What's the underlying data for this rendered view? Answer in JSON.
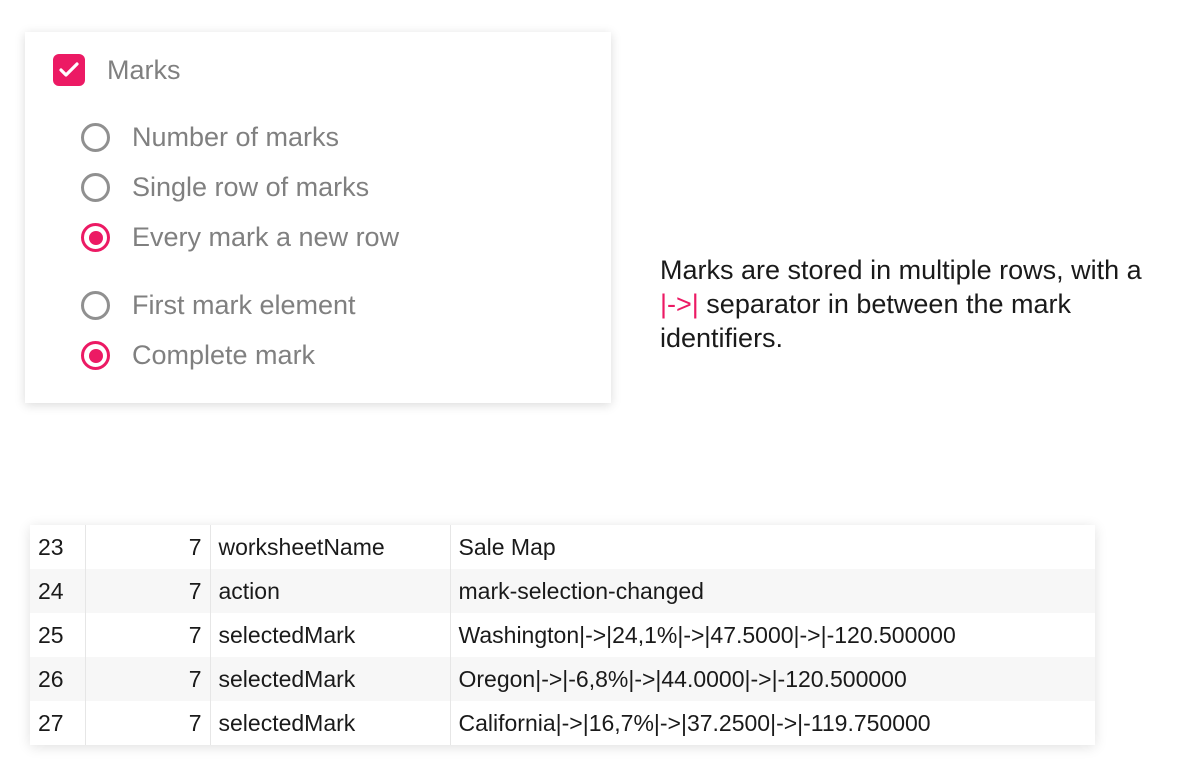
{
  "panel": {
    "title": "Marks",
    "options": [
      {
        "label": "Number of marks",
        "selected": false
      },
      {
        "label": "Single row of marks",
        "selected": false
      },
      {
        "label": "Every mark a new row",
        "selected": true
      }
    ],
    "options2": [
      {
        "label": "First mark element",
        "selected": false
      },
      {
        "label": "Complete mark",
        "selected": true
      }
    ]
  },
  "annotation": {
    "pre": "Marks are stored in multiple rows, with a ",
    "sep": "|->|",
    "post": " separator in between the mark identifiers."
  },
  "table": {
    "rows": [
      {
        "n": "23",
        "seq": "7",
        "key": "worksheetName",
        "val": "Sale Map"
      },
      {
        "n": "24",
        "seq": "7",
        "key": "action",
        "val": "mark-selection-changed"
      },
      {
        "n": "25",
        "seq": "7",
        "key": "selectedMark",
        "val": "Washington|->|24,1%|->|47.5000|->|-120.500000"
      },
      {
        "n": "26",
        "seq": "7",
        "key": "selectedMark",
        "val": "Oregon|->|-6,8%|->|44.0000|->|-120.500000"
      },
      {
        "n": "27",
        "seq": "7",
        "key": "selectedMark",
        "val": "California|->|16,7%|->|37.2500|->|-119.750000"
      }
    ]
  }
}
